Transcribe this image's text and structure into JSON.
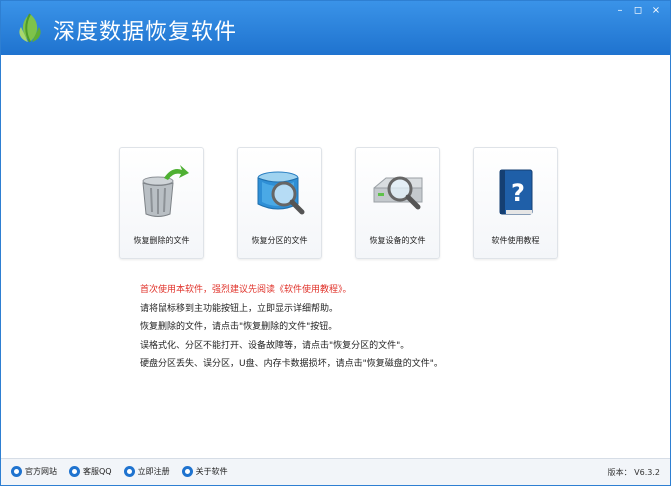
{
  "window": {
    "title": "深度数据恢复软件",
    "controls": {
      "minimize": "–",
      "restore": "◻",
      "close": "×"
    }
  },
  "cards": [
    {
      "label": "恢复删除的文件",
      "icon": "trash-restore-icon"
    },
    {
      "label": "恢复分区的文件",
      "icon": "partition-search-icon"
    },
    {
      "label": "恢复设备的文件",
      "icon": "device-search-icon"
    },
    {
      "label": "软件使用教程",
      "icon": "help-book-icon"
    }
  ],
  "tips": {
    "highlight": "首次使用本软件，强烈建议先阅读《软件使用教程》。",
    "lines": [
      "请将鼠标移到主功能按钮上，立即显示详细帮助。",
      "恢复删除的文件，请点击\"恢复删除的文件\"按钮。",
      "误格式化、分区不能打开、设备故障等，请点击\"恢复分区的文件\"。",
      "硬盘分区丢失、误分区，U盘、内存卡数据损坏，请点击\"恢复磁盘的文件\"。"
    ]
  },
  "statusbar": {
    "links": [
      {
        "label": "官方网站",
        "icon": "home-icon"
      },
      {
        "label": "客服QQ",
        "icon": "qq-icon"
      },
      {
        "label": "立即注册",
        "icon": "register-icon"
      },
      {
        "label": "关于软件",
        "icon": "info-icon"
      }
    ],
    "version": "版本： V6.3.2"
  },
  "colors": {
    "titlebar": "#2a86e0",
    "tip_highlight": "#e0322a"
  }
}
